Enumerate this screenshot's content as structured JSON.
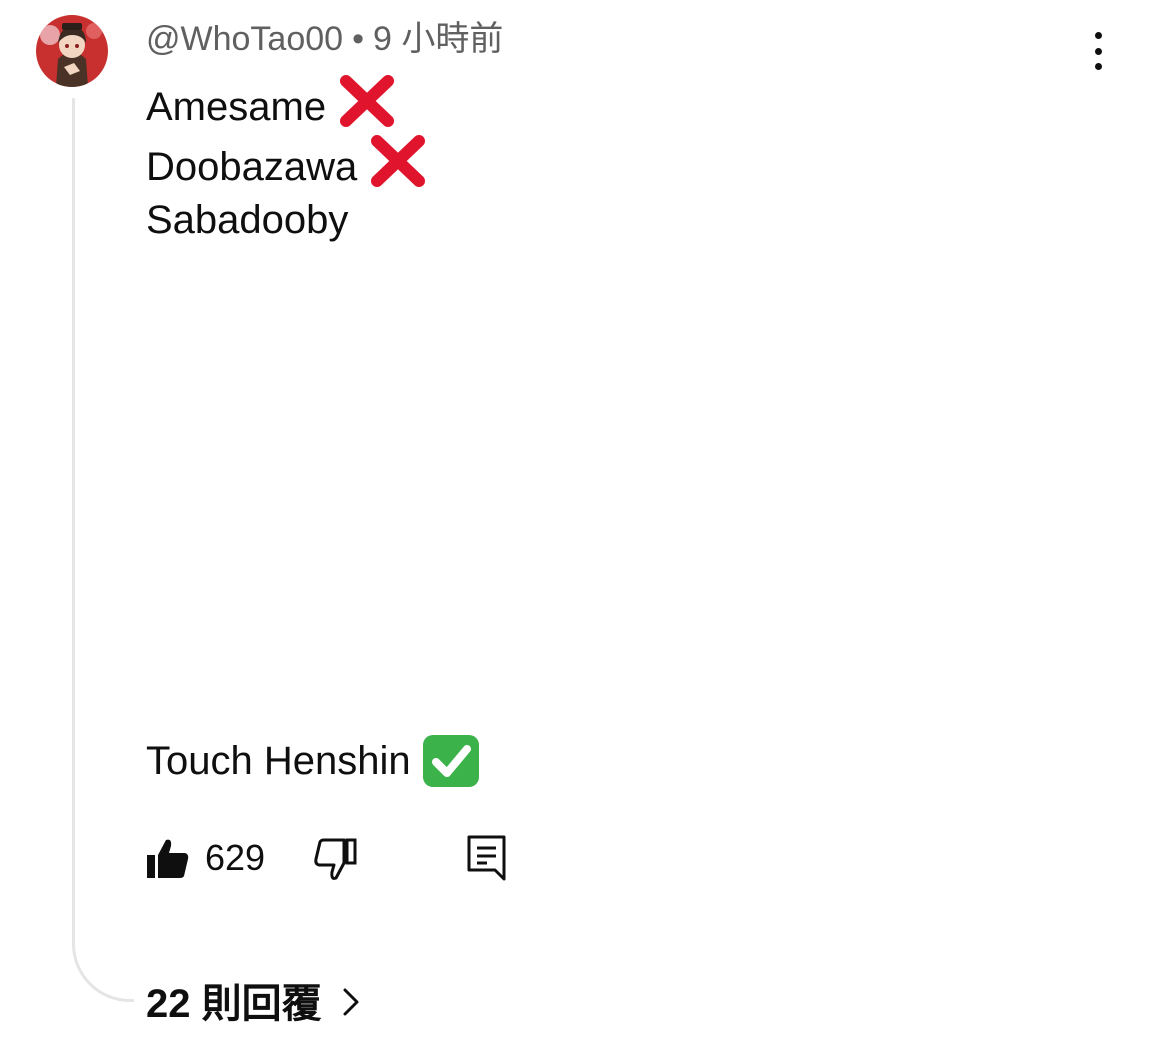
{
  "comment": {
    "author": "@WhoTao00",
    "separator": "•",
    "time": "9 小時前",
    "lines": [
      "Amesame",
      "Doobazawa",
      "Sabadooby"
    ],
    "last_line": "Touch Henshin",
    "line_icons": [
      "cross-mark-emoji",
      "cross-mark-emoji",
      "",
      "check-mark-emoji"
    ]
  },
  "actions": {
    "like_count": "629",
    "icons": {
      "like": "thumbs-up-filled-icon",
      "dislike": "thumbs-down-outline-icon",
      "reply": "comment-reply-icon",
      "more": "vertical-ellipsis-icon"
    }
  },
  "replies": {
    "label": "22 則回覆",
    "icon": "chevron-right-icon"
  },
  "colors": {
    "text_primary": "#0f0f0f",
    "text_secondary": "#606060",
    "thread_line": "#e5e5e5",
    "cross_red": "#e0142d",
    "check_green": "#3cb34a"
  }
}
